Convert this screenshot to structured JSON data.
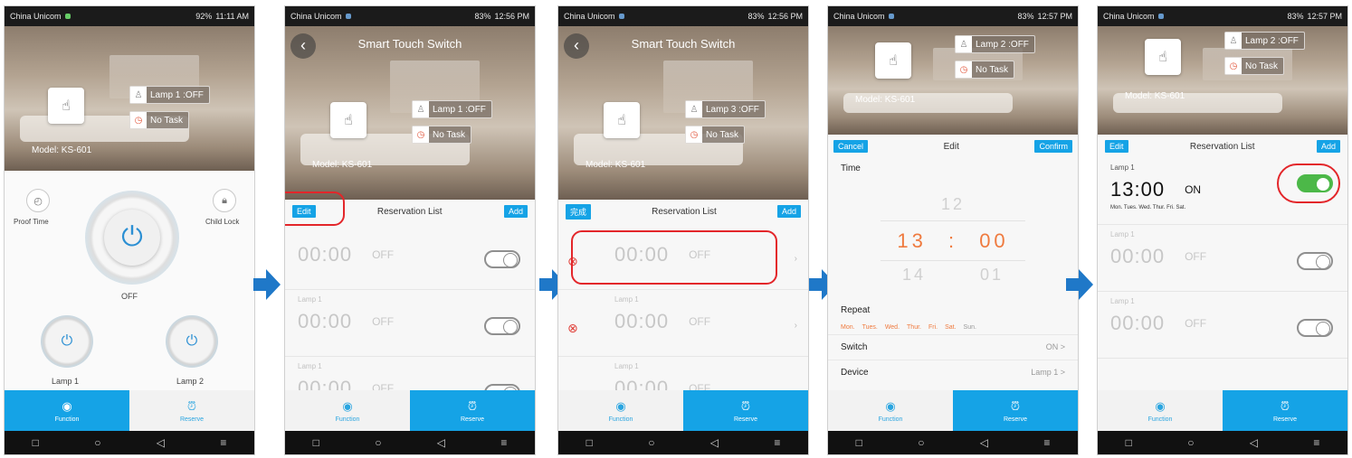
{
  "statusbars": [
    {
      "carrier": "China Unicom",
      "info": "92%",
      "time": "11:11 AM"
    },
    {
      "carrier": "China Unicom",
      "info": "83%",
      "time": "12:56 PM"
    },
    {
      "carrier": "China Unicom",
      "info": "83%",
      "time": "12:56 PM"
    },
    {
      "carrier": "China Unicom",
      "info": "83%",
      "time": "12:57 PM"
    },
    {
      "carrier": "China Unicom",
      "info": "83%",
      "time": "12:57 PM"
    }
  ],
  "app": {
    "title": "Smart Touch Switch",
    "model": "Model: KS-601"
  },
  "chips": {
    "lamp1_off": "Lamp 1 :OFF",
    "lamp3_off": "Lamp 3 :OFF",
    "lamp2_off": "Lamp 2 :OFF",
    "no_task": "No Task"
  },
  "screen1": {
    "proof_time": "Proof Time",
    "child_lock": "Child Lock",
    "power_state": "OFF",
    "lamp1": "Lamp 1",
    "lamp2": "Lamp 2"
  },
  "tabs": {
    "function": "Function",
    "reserve": "Reserve"
  },
  "reservation": {
    "edit": "Edit",
    "done_cn": "完成",
    "title": "Reservation List",
    "add": "Add",
    "lamp_label": "Lamp 1",
    "time": "00:00",
    "state": "OFF"
  },
  "edit_screen": {
    "cancel": "Cancel",
    "title": "Edit",
    "confirm": "Confirm",
    "time_label": "Time",
    "hour_prev": "12",
    "hour_sel": "13",
    "colon": ":",
    "min_sel": "00",
    "hour_next": "14",
    "min_next": "01",
    "repeat_label": "Repeat",
    "days": [
      "Mon.",
      "Tues.",
      "Wed.",
      "Thur.",
      "Fri.",
      "Sat.",
      "Sun."
    ],
    "switch_label": "Switch",
    "switch_value": "ON  >",
    "device_label": "Device",
    "device_value": "Lamp 1  >"
  },
  "result_item": {
    "lamp": "Lamp 1",
    "time": "13:00",
    "state": "ON",
    "days": "Mon.  Tues.  Wed.  Thur.  Fri.  Sat."
  },
  "colors": {
    "accent": "#15a3e6",
    "highlight": "#e3262a",
    "toggle_on": "#4cb848",
    "picker": "#ef7a3e"
  }
}
